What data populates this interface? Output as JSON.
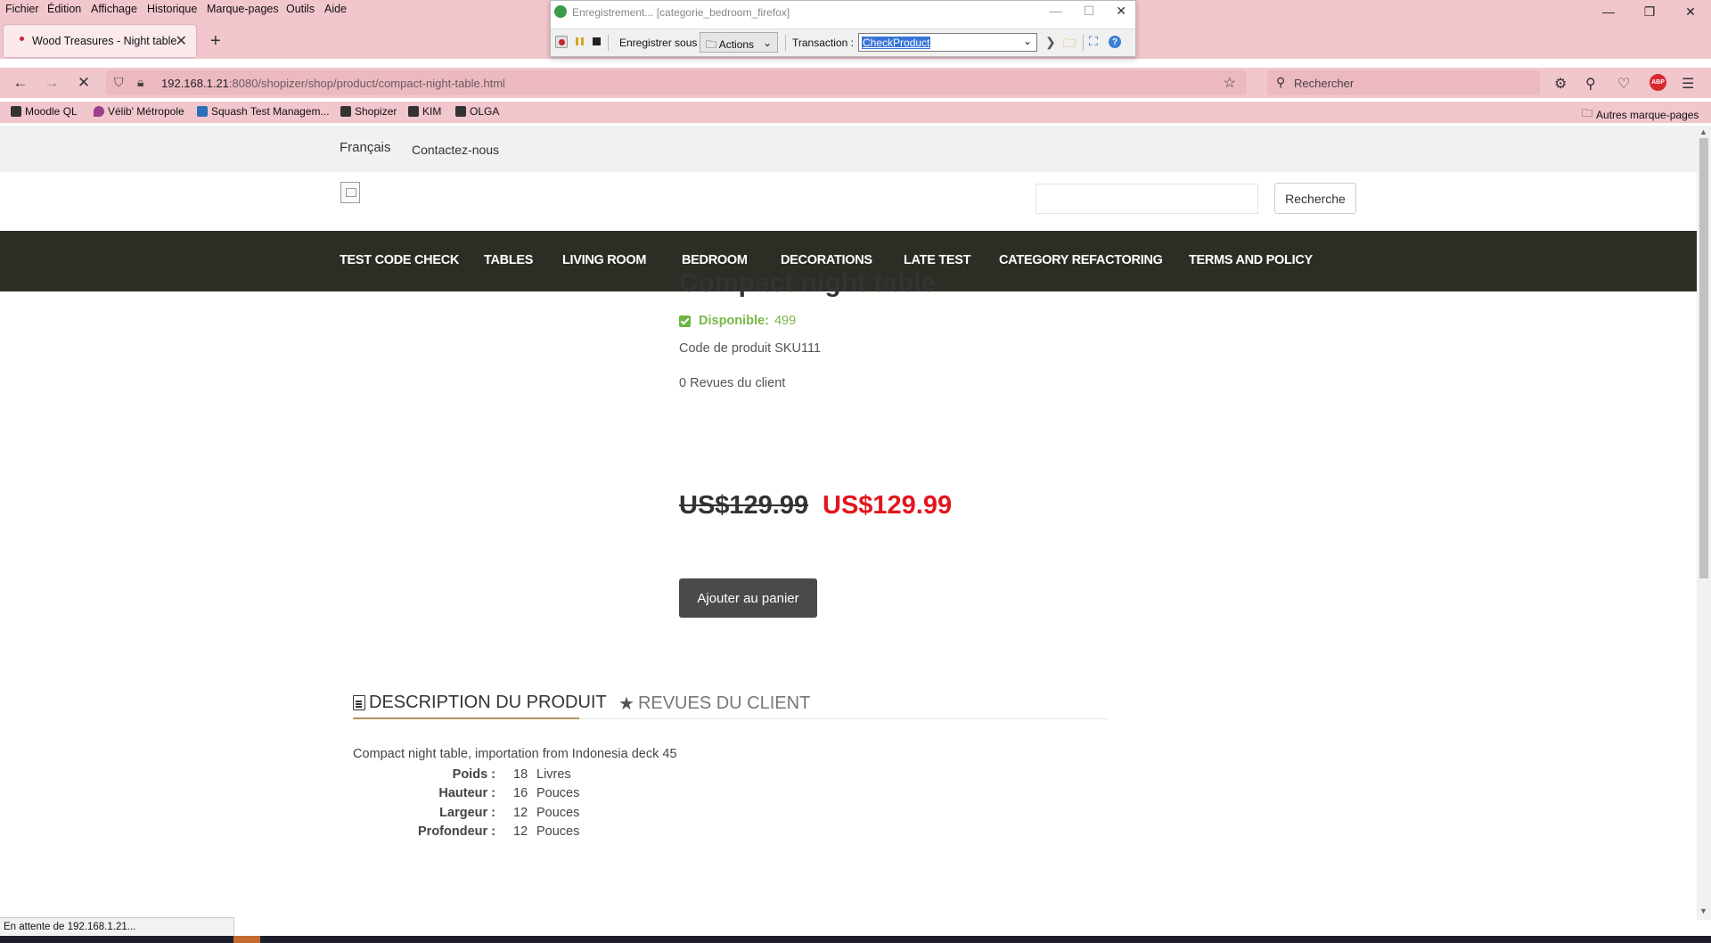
{
  "menubar": {
    "items": [
      "Fichier",
      "Édition",
      "Affichage",
      "Historique",
      "Marque-pages",
      "Outils",
      "Aide"
    ]
  },
  "window_controls": {
    "minimize": "—",
    "restore": "❐",
    "close": "✕"
  },
  "tab": {
    "title": "Wood Treasures - Night table",
    "close": "✕",
    "new_tab": "+"
  },
  "navbar": {
    "url_host": "192.168.1.21",
    "url_path": ":8080/shopizer/shop/product/compact-night-table.html",
    "search_placeholder": "Rechercher",
    "abp_label": "ABP"
  },
  "bookmarks": {
    "items": [
      "Moodle QL",
      "Vélib' Métropole",
      "Squash Test Managem...",
      "Shopizer",
      "KIM",
      "OLGA"
    ],
    "other": "Autres marque-pages"
  },
  "recorder": {
    "title": "Enregistrement... [categorie_bedroom_firefox]",
    "save_under_label": "Enregistrer sous :",
    "actions_value": "Actions",
    "transaction_label": "Transaction :",
    "transaction_value": "CheckProduct"
  },
  "shop": {
    "language": "Français",
    "contact": "Contactez-nous",
    "search_button": "Recherche",
    "nav": [
      "TEST CODE CHECK",
      "TABLES",
      "LIVING ROOM",
      "BEDROOM",
      "DECORATIONS",
      "LATE TEST",
      "CATEGORY REFACTORING",
      "TERMS AND POLICY"
    ]
  },
  "product": {
    "title": "Compact night table",
    "availability_label": "Disponible:",
    "availability_qty": "499",
    "sku": "Code de produit SKU111",
    "reviews": "0 Revues du client",
    "old_price": "US$129.99",
    "new_price": "US$129.99",
    "add_to_cart": "Ajouter au panier",
    "tabs": [
      "DESCRIPTION DU PRODUIT",
      "REVUES DU CLIENT"
    ],
    "description": "Compact night table, importation from Indonesia deck 45",
    "specs": [
      {
        "label": "Poids :",
        "value": "18",
        "unit": "Livres"
      },
      {
        "label": "Hauteur :",
        "value": "16",
        "unit": "Pouces"
      },
      {
        "label": "Largeur :",
        "value": "12",
        "unit": "Pouces"
      },
      {
        "label": "Profondeur :",
        "value": "12",
        "unit": "Pouces"
      }
    ]
  },
  "status": {
    "text": "En attente de 192.168.1.21..."
  },
  "colors": {
    "accent_red": "#e3161d",
    "available_green": "#7ab648",
    "nav_bg": "#2d2c25",
    "browser_chrome": "#f2c6cd"
  }
}
